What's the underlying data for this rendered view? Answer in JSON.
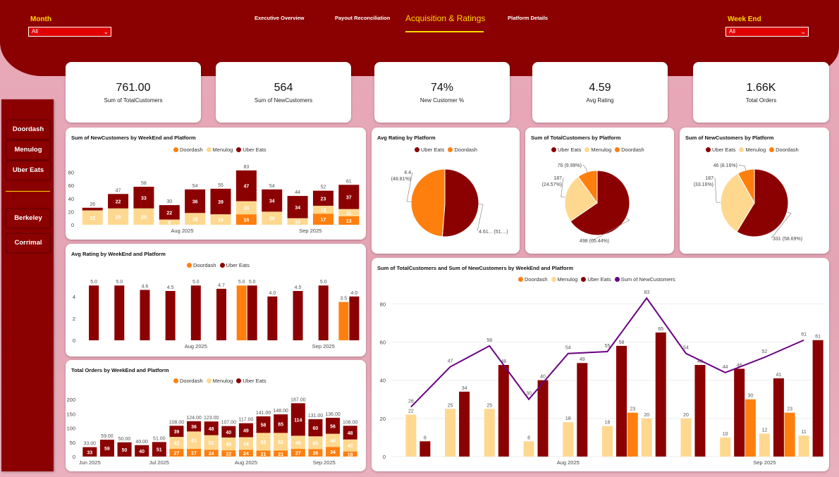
{
  "colors": {
    "brand": "#8b0000",
    "accent": "#ffd700",
    "doordash": "#ff7f0e",
    "menulog": "#ffd890",
    "ubereats": "#8b0000",
    "newcust_line": "#6a0080"
  },
  "slicers": {
    "month_label": "Month",
    "month_value": "All",
    "weekend_label": "Week End",
    "weekend_value": "All"
  },
  "nav": {
    "tabs": [
      "Executive Overview",
      "Payout Reconciliation",
      "Acquisition & Ratings",
      "Platform Details"
    ],
    "active": "Acquisition & Ratings"
  },
  "kpis": [
    {
      "value": "761.00",
      "label": "Sum of TotalCustomers"
    },
    {
      "value": "564",
      "label": "Sum of NewCustomers"
    },
    {
      "value": "74%",
      "label": "New Customer %"
    },
    {
      "value": "4.59",
      "label": "Avg Rating"
    },
    {
      "value": "1.66K",
      "label": "Total Orders"
    }
  ],
  "sidebar": {
    "platforms": [
      "Doordash",
      "Menulog",
      "Uber Eats"
    ],
    "stores": [
      "Berkeley",
      "Corrimal"
    ]
  },
  "chart_data": [
    {
      "id": "newcust",
      "type": "bar",
      "title": "Sum of NewCustomers by WeekEnd and Platform",
      "legend": [
        "Doordash",
        "Menulog",
        "Uber Eats"
      ],
      "yticks": [
        0,
        20,
        40,
        60,
        80
      ],
      "ylim": [
        0,
        85
      ],
      "xlabels": [
        {
          "i": 3.5,
          "t": "Aug 2025"
        },
        {
          "i": 8.5,
          "t": "Sep 2025"
        }
      ],
      "stacks": [
        [
          {
            "s": "Menulog",
            "v": 22
          },
          {
            "s": "Uber Eats",
            "v": 4
          }
        ],
        [
          {
            "s": "Menulog",
            "v": 25
          },
          {
            "s": "Uber Eats",
            "v": 22
          }
        ],
        [
          {
            "s": "Menulog",
            "v": 25
          },
          {
            "s": "Uber Eats",
            "v": 33
          }
        ],
        [
          {
            "s": "Menulog",
            "v": 8
          },
          {
            "s": "Uber Eats",
            "v": 22
          }
        ],
        [
          {
            "s": "Menulog",
            "v": 18
          },
          {
            "s": "Uber Eats",
            "v": 36
          }
        ],
        [
          {
            "s": "Menulog",
            "v": 16
          },
          {
            "s": "Uber Eats",
            "v": 39
          }
        ],
        [
          {
            "s": "Doordash",
            "v": 16
          },
          {
            "s": "Menulog",
            "v": 20
          },
          {
            "s": "Uber Eats",
            "v": 47
          }
        ],
        [
          {
            "s": "Menulog",
            "v": 20
          },
          {
            "s": "Uber Eats",
            "v": 34
          }
        ],
        [
          {
            "s": "Menulog",
            "v": 10
          },
          {
            "s": "Uber Eats",
            "v": 34
          }
        ],
        [
          {
            "s": "Doordash",
            "v": 17
          },
          {
            "s": "Menulog",
            "v": 12
          },
          {
            "s": "Uber Eats",
            "v": 23
          }
        ],
        [
          {
            "s": "Doordash",
            "v": 13
          },
          {
            "s": "Menulog",
            "v": 11
          },
          {
            "s": "Uber Eats",
            "v": 37
          }
        ]
      ],
      "totals": [
        26,
        47,
        58,
        30,
        54,
        55,
        83,
        54,
        44,
        52,
        61
      ]
    },
    {
      "id": "avgrating",
      "type": "bar",
      "title": "Avg Rating by WeekEnd and Platform",
      "legend": [
        "Doordash",
        "Uber Eats"
      ],
      "yticks": [
        0,
        2,
        4
      ],
      "ylim": [
        0,
        5.4
      ],
      "xlabels": [
        {
          "i": 4,
          "t": "Aug 2025"
        },
        {
          "i": 9,
          "t": "Sep 2025"
        }
      ],
      "groups": [
        [
          {
            "s": "Uber Eats",
            "v": 5.0
          }
        ],
        [
          {
            "s": "Uber Eats",
            "v": 5.0
          }
        ],
        [
          {
            "s": "Uber Eats",
            "v": 4.6
          }
        ],
        [
          {
            "s": "Uber Eats",
            "v": 4.5
          }
        ],
        [
          {
            "s": "Uber Eats",
            "v": 5.0
          }
        ],
        [
          {
            "s": "Uber Eats",
            "v": 4.7
          }
        ],
        [
          {
            "s": "Doordash",
            "v": 5.0
          },
          {
            "s": "Uber Eats",
            "v": 5.0
          }
        ],
        [
          {
            "s": "Uber Eats",
            "v": 4.0
          }
        ],
        [
          {
            "s": "Uber Eats",
            "v": 4.5
          }
        ],
        [
          {
            "s": "Uber Eats",
            "v": 5.0
          }
        ],
        [
          {
            "s": "Doordash",
            "v": 3.5
          },
          {
            "s": "Uber Eats",
            "v": 4.0
          }
        ]
      ]
    },
    {
      "id": "orders",
      "type": "bar",
      "title": "Total Orders by WeekEnd and Platform",
      "legend": [
        "Doordash",
        "Menulog",
        "Uber Eats"
      ],
      "yticks": [
        0,
        50,
        100,
        150,
        200
      ],
      "ylim": [
        0,
        210
      ],
      "xlabels": [
        {
          "i": 0,
          "t": "Jun 2025"
        },
        {
          "i": 4,
          "t": "Jul 2025"
        },
        {
          "i": 9,
          "t": "Aug 2025"
        },
        {
          "i": 13.5,
          "t": "Sep 2025"
        }
      ],
      "stacks": [
        [
          {
            "s": "Uber Eats",
            "v": 33
          }
        ],
        [
          {
            "s": "Uber Eats",
            "v": 59
          }
        ],
        [
          {
            "s": "Uber Eats",
            "v": 50
          }
        ],
        [
          {
            "s": "Uber Eats",
            "v": 40
          }
        ],
        [
          {
            "s": "Uber Eats",
            "v": 51
          }
        ],
        [
          {
            "s": "Doordash",
            "v": 27
          },
          {
            "s": "Menulog",
            "v": 42
          },
          {
            "s": "Uber Eats",
            "v": 39
          }
        ],
        [
          {
            "s": "Doordash",
            "v": 27
          },
          {
            "s": "Menulog",
            "v": 61
          },
          {
            "s": "Uber Eats",
            "v": 36
          }
        ],
        [
          {
            "s": "Doordash",
            "v": 24
          },
          {
            "s": "Menulog",
            "v": 51
          },
          {
            "s": "Uber Eats",
            "v": 48
          }
        ],
        [
          {
            "s": "Doordash",
            "v": 22
          },
          {
            "s": "Menulog",
            "v": 45
          },
          {
            "s": "Uber Eats",
            "v": 40
          }
        ],
        [
          {
            "s": "Doordash",
            "v": 24
          },
          {
            "s": "Menulog",
            "v": 44
          },
          {
            "s": "Uber Eats",
            "v": 49
          }
        ],
        [
          {
            "s": "Doordash",
            "v": 21
          },
          {
            "s": "Menulog",
            "v": 62
          },
          {
            "s": "Uber Eats",
            "v": 58
          }
        ],
        [
          {
            "s": "Doordash",
            "v": 21
          },
          {
            "s": "Menulog",
            "v": 62
          },
          {
            "s": "Uber Eats",
            "v": 65
          }
        ],
        [
          {
            "s": "Doordash",
            "v": 27
          },
          {
            "s": "Menulog",
            "v": 46
          },
          {
            "s": "Uber Eats",
            "v": 114
          }
        ],
        [
          {
            "s": "Doordash",
            "v": 26
          },
          {
            "s": "Menulog",
            "v": 45
          },
          {
            "s": "Uber Eats",
            "v": 60
          }
        ],
        [
          {
            "s": "Doordash",
            "v": 34
          },
          {
            "s": "Menulog",
            "v": 46
          },
          {
            "s": "Uber Eats",
            "v": 56
          }
        ],
        [
          {
            "s": "Doordash",
            "v": 18
          },
          {
            "s": "Menulog",
            "v": 42
          },
          {
            "s": "Uber Eats",
            "v": 48
          }
        ]
      ],
      "totals": [
        "33.00",
        "59.00",
        "50.00",
        "40.00",
        "51.00",
        "108.00",
        "124.00",
        "123.00",
        "107.00",
        "117.00",
        "141.00",
        "148.00",
        "187.00",
        "131.00",
        "136.00",
        "108.00"
      ]
    },
    {
      "id": "pie_rating",
      "type": "pie",
      "title": "Avg Rating by Platform",
      "legend": [
        "Uber Eats",
        "Doordash"
      ],
      "slices": [
        {
          "name": "Uber Eats",
          "value": 51.19,
          "label": "4.61... (51....)"
        },
        {
          "name": "Doordash",
          "value": 48.81,
          "label": "4.4\n(48.81%)"
        }
      ]
    },
    {
      "id": "pie_total",
      "type": "pie",
      "title": "Sum of TotalCustomers by Platform",
      "legend": [
        "Uber Eats",
        "Menulog",
        "Doordash"
      ],
      "slices": [
        {
          "name": "Uber Eats",
          "value": 65.44,
          "label": "498 (65.44%)"
        },
        {
          "name": "Menulog",
          "value": 24.57,
          "label": "187\n(24.57%)"
        },
        {
          "name": "Doordash",
          "value": 9.99,
          "label": "76 (9.99%)"
        }
      ]
    },
    {
      "id": "pie_new",
      "type": "pie",
      "title": "Sum of NewCustomers by Platform",
      "legend": [
        "Uber Eats",
        "Menulog",
        "Doordash"
      ],
      "slices": [
        {
          "name": "Uber Eats",
          "value": 58.69,
          "label": "331 (58.69%)"
        },
        {
          "name": "Menulog",
          "value": 33.16,
          "label": "187\n(33.16%)"
        },
        {
          "name": "Doordash",
          "value": 8.16,
          "label": "46 (8.16%)"
        }
      ]
    },
    {
      "id": "combo",
      "type": "bar",
      "title": "Sum of TotalCustomers and Sum of NewCustomers by WeekEnd and Platform",
      "legend": [
        "Doordash",
        "Menulog",
        "Uber Eats",
        "Sum of NewCustomers"
      ],
      "yticks": [
        0,
        20,
        40,
        60,
        80
      ],
      "ylim": [
        0,
        86
      ],
      "xlabels": [
        {
          "i": 4,
          "t": "Aug 2025"
        },
        {
          "i": 9,
          "t": "Sep 2025"
        }
      ],
      "groups": [
        [
          {
            "s": "Menulog",
            "v": 22
          },
          {
            "s": "Uber Eats",
            "v": 8
          }
        ],
        [
          {
            "s": "Menulog",
            "v": 25
          },
          {
            "s": "Uber Eats",
            "v": 34
          }
        ],
        [
          {
            "s": "Menulog",
            "v": 25
          },
          {
            "s": "Uber Eats",
            "v": 48
          }
        ],
        [
          {
            "s": "Menulog",
            "v": 8
          },
          {
            "s": "Uber Eats",
            "v": 40
          }
        ],
        [
          {
            "s": "Menulog",
            "v": 18
          },
          {
            "s": "Uber Eats",
            "v": 49
          }
        ],
        [
          {
            "s": "Menulog",
            "v": 16
          },
          {
            "s": "Uber Eats",
            "v": 58
          }
        ],
        [
          {
            "s": "Doordash",
            "v": 23
          },
          {
            "s": "Menulog",
            "v": 20
          },
          {
            "s": "Uber Eats",
            "v": 65
          }
        ],
        [
          {
            "s": "Menulog",
            "v": 20
          },
          {
            "s": "Uber Eats",
            "v": 48
          }
        ],
        [
          {
            "s": "Menulog",
            "v": 10
          },
          {
            "s": "Uber Eats",
            "v": 46
          }
        ],
        [
          {
            "s": "Doordash",
            "v": 30
          },
          {
            "s": "Menulog",
            "v": 12
          },
          {
            "s": "Uber Eats",
            "v": 41
          }
        ],
        [
          {
            "s": "Doordash",
            "v": 23
          },
          {
            "s": "Menulog",
            "v": 11
          },
          {
            "s": "Uber Eats",
            "v": 61
          }
        ]
      ],
      "line": {
        "name": "Sum of NewCustomers",
        "values": [
          26,
          47,
          58,
          30,
          54,
          55,
          83,
          54,
          44,
          52,
          61
        ]
      }
    }
  ]
}
